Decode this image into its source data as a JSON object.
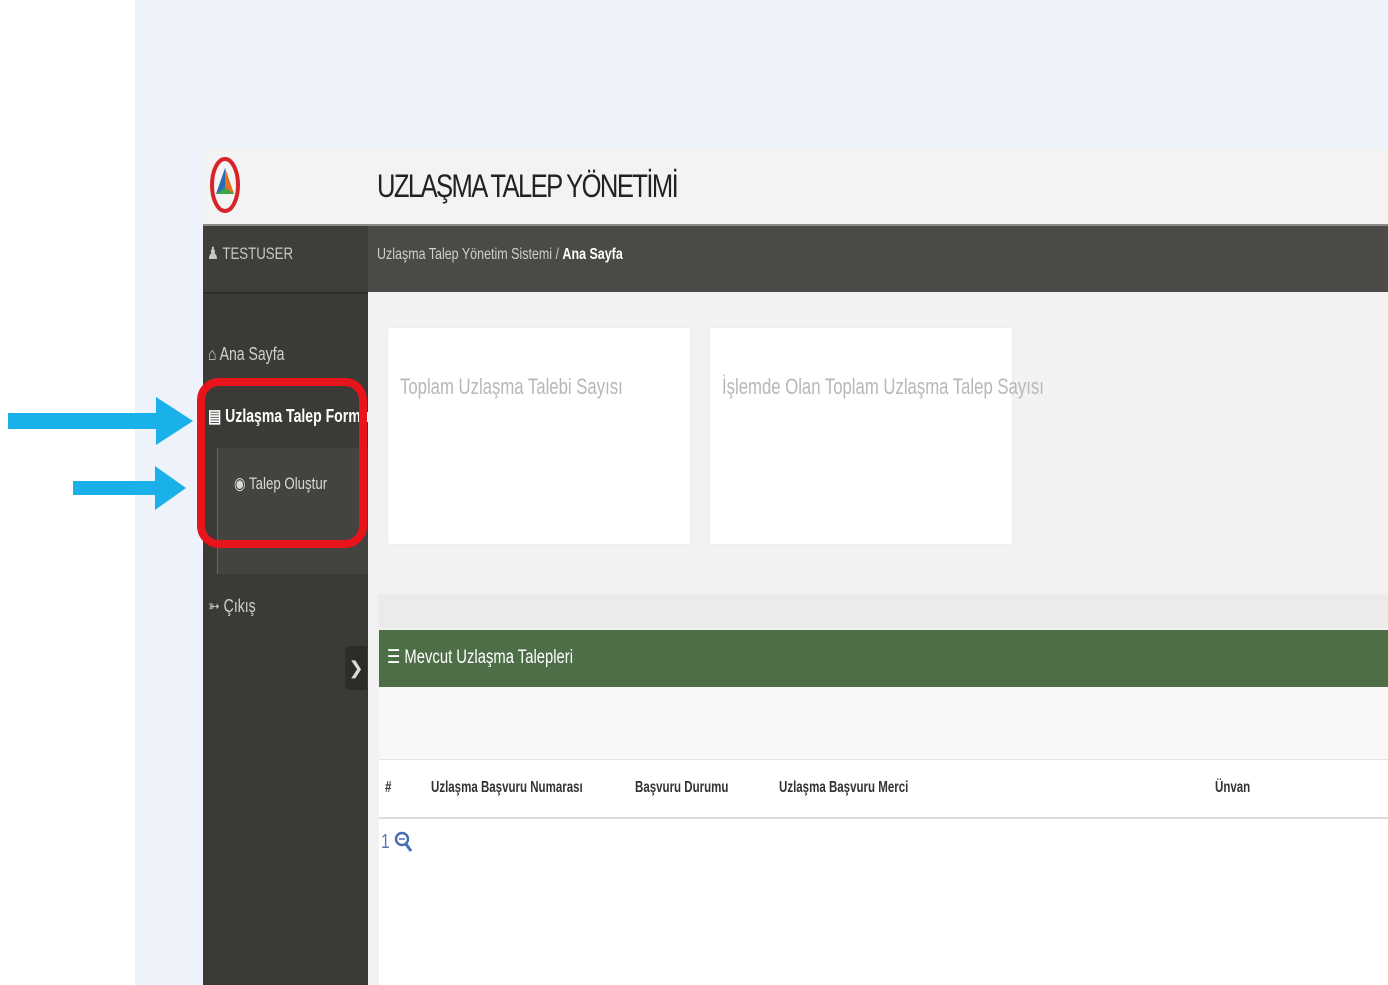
{
  "header": {
    "title": "UZLAŞMA TALEP YÖNETİMİ",
    "logo_icon": "triangle-logo-icon"
  },
  "sidebar": {
    "user": "TESTUSER",
    "user_icon": "user-icon",
    "items": [
      {
        "label": "Ana Sayfa",
        "icon": "home-icon"
      },
      {
        "label": "Uzlaşma Talep Formu",
        "icon": "document-icon"
      },
      {
        "label": "Çıkış",
        "icon": "logout-icon"
      }
    ],
    "submenu": [
      {
        "label": "Talep Oluştur",
        "icon": "circle-icon"
      }
    ],
    "collapse_icon": "chevron-circle-icon"
  },
  "breadcrumb": {
    "root": "Uzlaşma Talep Yönetim Sistemi /",
    "current": "Ana Sayfa"
  },
  "stats": [
    {
      "label": "Toplam Uzlaşma Talebi Sayısı"
    },
    {
      "label": "İşlemde Olan Toplam Uzlaşma Talep Sayısı"
    }
  ],
  "panel": {
    "title": "Mevcut Uzlaşma Talepleri",
    "title_icon": "list-icon",
    "columns": [
      "#",
      "Uzlaşma Başvuru Numarası",
      "Başvuru Durumu",
      "Uzlaşma Başvuru Merci",
      "Ünvan"
    ],
    "rows": [
      {
        "num": "1",
        "action_icon": "search-icon"
      }
    ]
  },
  "colors": {
    "sidebar_bg": "#3b3a37",
    "breadcrumb_bg": "#4b4a46",
    "panel_header_bg": "#4e6e48",
    "highlight": "#e8141b",
    "arrow": "#1ab0ea"
  }
}
